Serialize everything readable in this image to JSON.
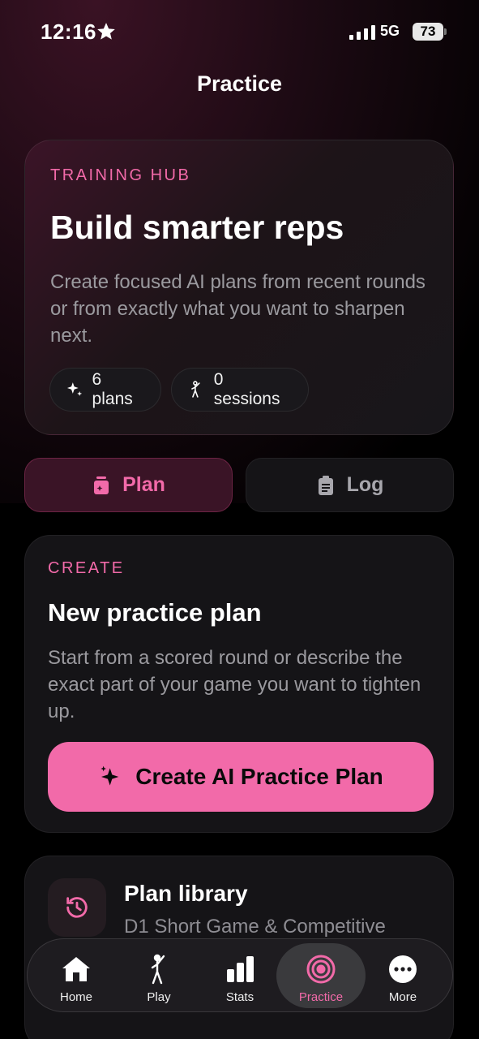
{
  "status_bar": {
    "time": "12:16",
    "network": "5G",
    "battery": "73"
  },
  "page": {
    "title": "Practice"
  },
  "hero": {
    "eyebrow": "TRAINING HUB",
    "title": "Build smarter reps",
    "description": "Create focused AI plans from recent rounds or from exactly what you want to sharpen next.",
    "chips": [
      {
        "label": "6 plans",
        "icon": "sparkle-icon"
      },
      {
        "label": "0 sessions",
        "icon": "golfer-icon"
      }
    ]
  },
  "segments": [
    {
      "label": "Plan",
      "icon": "plan-icon",
      "active": true
    },
    {
      "label": "Log",
      "icon": "clipboard-icon",
      "active": false
    }
  ],
  "create": {
    "eyebrow": "CREATE",
    "title": "New practice plan",
    "description": "Start from a scored round or describe the exact part of your game you want to tighten up.",
    "button_label": "Create AI Practice Plan"
  },
  "library": {
    "title": "Plan library",
    "subtitle": "D1 Short Game & Competitive"
  },
  "tabbar": [
    {
      "label": "Home",
      "icon": "home-icon"
    },
    {
      "label": "Play",
      "icon": "golfer-icon"
    },
    {
      "label": "Stats",
      "icon": "bar-chart-icon"
    },
    {
      "label": "Practice",
      "icon": "target-icon",
      "active": true
    },
    {
      "label": "More",
      "icon": "more-icon"
    }
  ],
  "colors": {
    "accent": "#f26aa9",
    "background": "#000000",
    "card": "#151417"
  }
}
